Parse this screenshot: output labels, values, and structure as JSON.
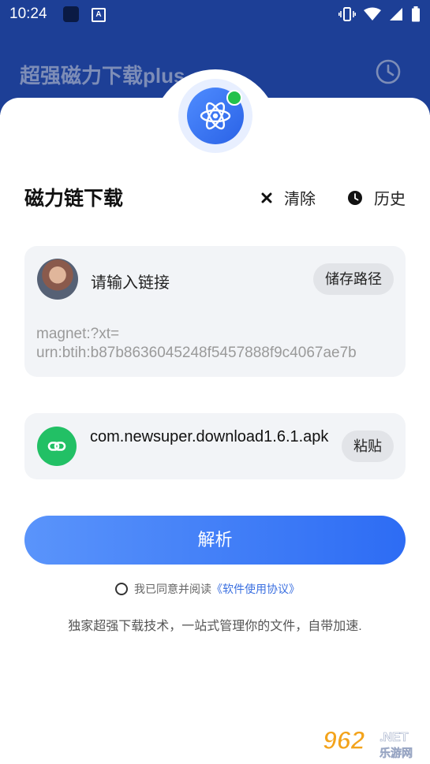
{
  "status_bar": {
    "time": "10:24"
  },
  "app_bar": {
    "title": "超强磁力下载plus"
  },
  "panel": {
    "title": "磁力链下载",
    "clear_label": "清除",
    "history_label": "历史"
  },
  "link_card": {
    "prompt": "请输入链接",
    "save_path_label": "储存路径",
    "magnet_line1": "magnet:?xt=",
    "magnet_line2": "urn:btih:b87b8636045248f5457888f9c4067ae7b"
  },
  "package_card": {
    "package_name": "com.newsuper.download1.6.1.apk",
    "paste_label": "粘贴"
  },
  "parse_button_label": "解析",
  "agreement": {
    "prefix": "我已同意并阅读",
    "link": "《软件使用协议》"
  },
  "tagline": "独家超强下载技术，一站式管理你的文件，自带加速.",
  "watermark": {
    "number": "962",
    "suffix": ".NET",
    "site": "乐游网"
  },
  "colors": {
    "header_bg": "#1d3f96",
    "accent": "#2d6cf4",
    "link_icon": "#22c065",
    "online_dot": "#23c14a"
  }
}
